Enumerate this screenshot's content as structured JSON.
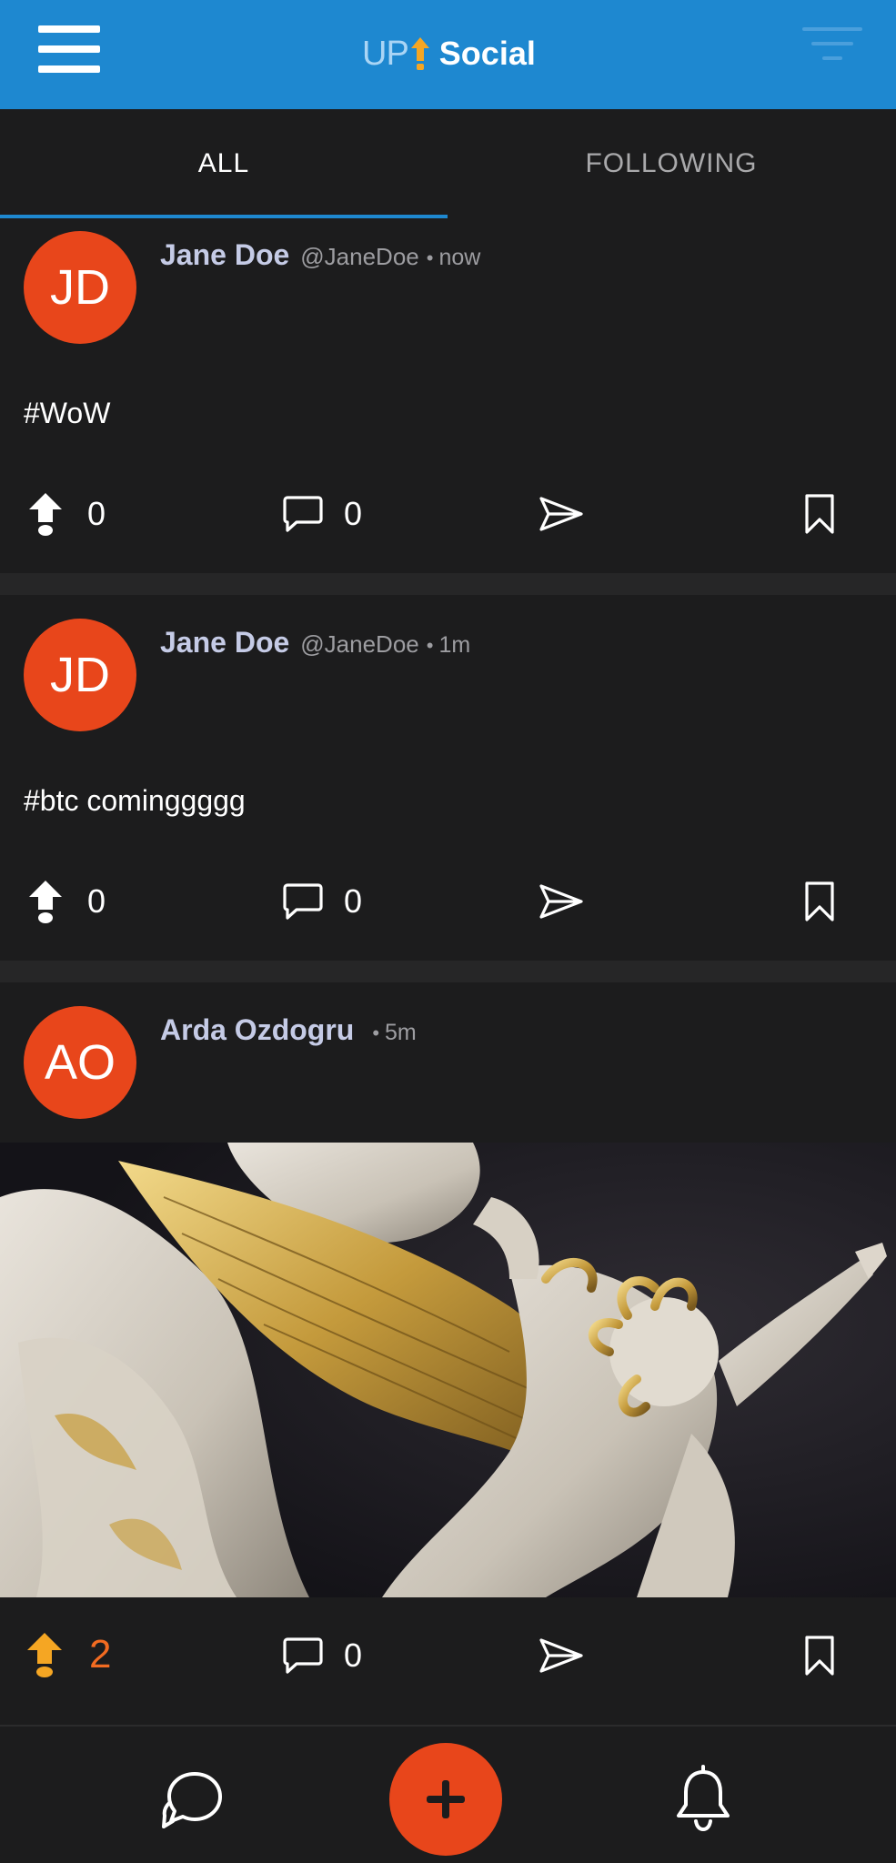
{
  "app": {
    "logo_up": "UP",
    "logo_social": "Social",
    "header_color": "#1e88d0",
    "accent_color": "#e8461b"
  },
  "header": {
    "menu_icon": "hamburger-menu-icon",
    "filter_icon": "filter-icon"
  },
  "tabs": [
    {
      "label": "ALL",
      "active": true
    },
    {
      "label": "FOLLOWING",
      "active": false
    }
  ],
  "posts": [
    {
      "avatar_initials": "JD",
      "author": "Jane Doe",
      "handle": "@JaneDoe",
      "separator": "•",
      "time": "now",
      "text": "#WoW",
      "upvotes": "0",
      "upvoted": false,
      "comments": "0"
    },
    {
      "avatar_initials": "JD",
      "author": "Jane Doe",
      "handle": "@JaneDoe",
      "separator": "•",
      "time": "1m",
      "text": "#btc cominggggg",
      "upvotes": "0",
      "upvoted": false,
      "comments": "0"
    },
    {
      "avatar_initials": "AO",
      "author": "Arda Ozdogru",
      "handle": "",
      "separator": "•",
      "time": "5m",
      "text": "",
      "has_image": true,
      "upvotes": "2",
      "upvoted": true,
      "comments": "0"
    }
  ],
  "bottom_nav": {
    "chat_icon": "chat-bubbles-icon",
    "add_icon": "plus-icon",
    "notifications_icon": "bell-icon"
  }
}
